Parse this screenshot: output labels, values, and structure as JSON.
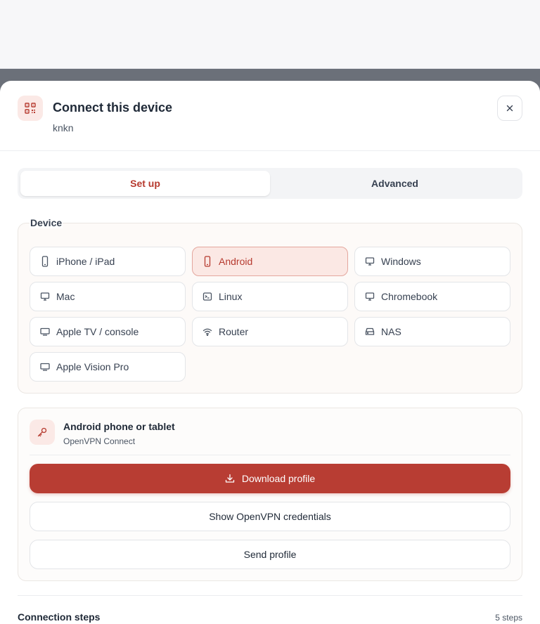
{
  "modal": {
    "title": "Connect this device",
    "subtitle": "knkn",
    "header_icon": "qr-code-icon",
    "close_icon": "close-icon"
  },
  "tabs": [
    {
      "label": "Set up",
      "active": true
    },
    {
      "label": "Advanced",
      "active": false
    }
  ],
  "device": {
    "legend": "Device",
    "selected": "Android",
    "options": [
      {
        "label": "iPhone / iPad",
        "icon": "phone-icon"
      },
      {
        "label": "Android",
        "icon": "phone-icon"
      },
      {
        "label": "Windows",
        "icon": "monitor-icon"
      },
      {
        "label": "Mac",
        "icon": "monitor-icon"
      },
      {
        "label": "Linux",
        "icon": "terminal-icon"
      },
      {
        "label": "Chromebook",
        "icon": "monitor-icon"
      },
      {
        "label": "Apple TV / console",
        "icon": "tv-icon"
      },
      {
        "label": "Router",
        "icon": "wifi-icon"
      },
      {
        "label": "NAS",
        "icon": "storage-icon"
      },
      {
        "label": "Apple Vision Pro",
        "icon": "tv-icon"
      }
    ]
  },
  "profile": {
    "icon": "key-icon",
    "title": "Android phone or tablet",
    "subtitle": "OpenVPN Connect",
    "download_label": "Download profile",
    "download_icon": "download-icon",
    "credentials_label": "Show OpenVPN credentials",
    "send_label": "Send profile"
  },
  "steps": {
    "title": "Connection steps",
    "count": "5 steps"
  },
  "colors": {
    "accent": "#b83d33",
    "accent_soft": "#fbe8e4",
    "overlay": "#6b7079"
  }
}
